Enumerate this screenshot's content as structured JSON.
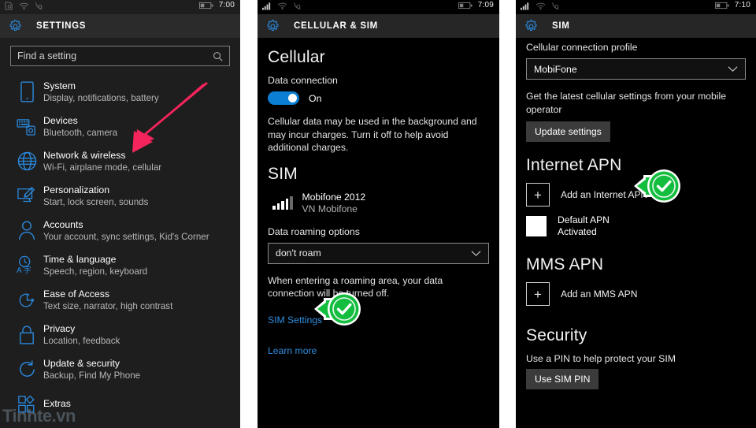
{
  "panels": {
    "settings": {
      "status": {
        "time": "7:00",
        "icons": [
          "sim-status-icon",
          "wifi-icon",
          "call-forward-icon",
          "battery-icon"
        ]
      },
      "header": {
        "title": "SETTINGS",
        "icon": "gear-icon"
      },
      "search": {
        "placeholder": "Find a setting",
        "value": "",
        "icon": "search-icon"
      },
      "items": [
        {
          "title": "System",
          "subtitle": "Display, notifications, battery",
          "icon": "phone-icon"
        },
        {
          "title": "Devices",
          "subtitle": "Bluetooth, camera",
          "icon": "devices-icon"
        },
        {
          "title": "Network & wireless",
          "subtitle": "Wi-Fi, airplane mode, cellular",
          "icon": "globe-icon"
        },
        {
          "title": "Personalization",
          "subtitle": "Start, lock screen, sounds",
          "icon": "brush-icon"
        },
        {
          "title": "Accounts",
          "subtitle": "Your account, sync settings, Kid's Corner",
          "icon": "person-icon"
        },
        {
          "title": "Time & language",
          "subtitle": "Speech, region, keyboard",
          "icon": "clock-language-icon"
        },
        {
          "title": "Ease of Access",
          "subtitle": "Text size, narrator, high contrast",
          "icon": "ease-of-access-icon"
        },
        {
          "title": "Privacy",
          "subtitle": "Location, feedback",
          "icon": "lock-icon"
        },
        {
          "title": "Update & security",
          "subtitle": "Backup, Find My Phone",
          "icon": "refresh-icon"
        },
        {
          "title": "Extras",
          "subtitle": "",
          "icon": "extras-icon"
        }
      ],
      "watermark": "Tinhte.vn"
    },
    "cellular": {
      "status": {
        "time": "7:09",
        "icons": [
          "signal-icon",
          "wifi-icon",
          "call-forward-icon",
          "battery-icon"
        ]
      },
      "header": {
        "title": "CELLULAR & SIM",
        "icon": "gear-icon"
      },
      "cellular_heading": "Cellular",
      "data_connection_label": "Data connection",
      "data_connection_state": "On",
      "cellular_description": "Cellular data may be used in the background and may incur charges. Turn it off to help avoid additional charges.",
      "sim_heading": "SIM",
      "sim_name": "Mobifone 2012",
      "sim_carrier": "VN Mobifone",
      "roaming_label": "Data roaming options",
      "roaming_value": "don't roam",
      "roaming_description": "When entering a roaming area, your data connection will be turned off.",
      "sim_settings_link": "SIM Settings",
      "learn_more_link": "Learn more"
    },
    "sim": {
      "status": {
        "time": "7:10",
        "icons": [
          "signal-icon",
          "wifi-icon",
          "call-forward-icon",
          "battery-icon"
        ]
      },
      "header": {
        "title": "SIM",
        "icon": "gear-icon"
      },
      "profile_label": "Cellular connection profile",
      "profile_value": "MobiFone",
      "update_description": "Get the latest cellular settings from your mobile operator",
      "update_button": "Update settings",
      "internet_apn_heading": "Internet APN",
      "add_internet_apn": "Add an Internet APN",
      "default_apn_title": "Default APN",
      "default_apn_state": "Activated",
      "mms_apn_heading": "MMS APN",
      "add_mms_apn": "Add an MMS APN",
      "security_heading": "Security",
      "security_description": "Use a PIN to help protect your SIM",
      "sim_pin_button": "Use SIM PIN"
    }
  },
  "annotations": {
    "arrow_color": "#F5245C",
    "highlight_color": "#13BE3F",
    "check_glyph": "check-mark",
    "callouts": [
      {
        "target": "Network & wireless",
        "type": "pink-arrow"
      },
      {
        "target": "SIM Settings",
        "type": "green-check-arrow"
      },
      {
        "target": "Add an Internet APN",
        "type": "green-check-arrow"
      }
    ]
  },
  "colors": {
    "accent": "#0078D7",
    "panel_dark": "#1E1E1E",
    "panel_black": "#000000",
    "link": "#2F8EE0"
  }
}
